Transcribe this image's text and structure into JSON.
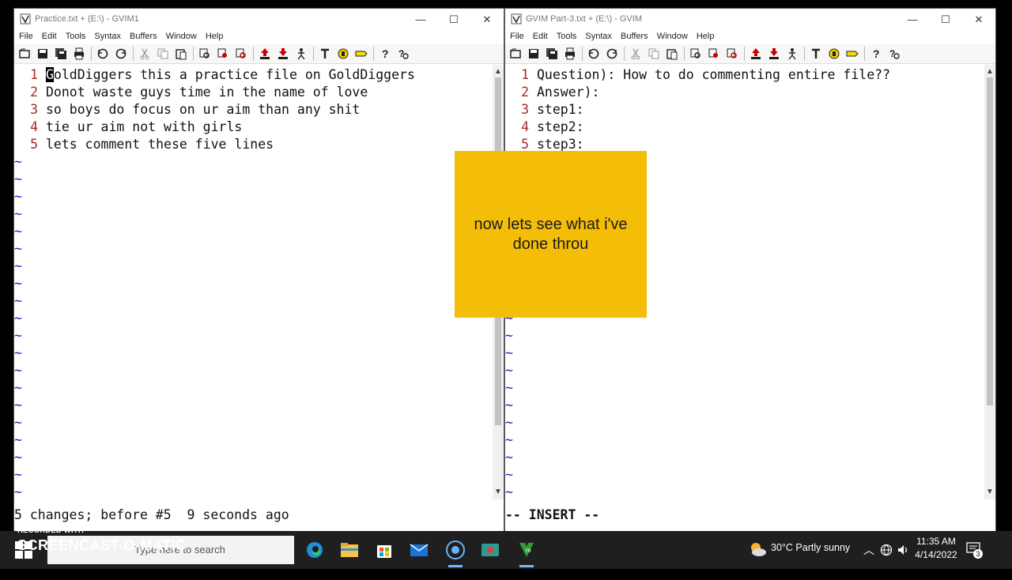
{
  "left_window": {
    "title": "Practice.txt + (E:\\) - GVIM1",
    "menu": [
      "File",
      "Edit",
      "Tools",
      "Syntax",
      "Buffers",
      "Window",
      "Help"
    ],
    "lines": [
      {
        "num": "1",
        "first": "G",
        "rest": "oldDiggers this a practice file on GoldDiggers"
      },
      {
        "num": "2",
        "text": "Donot waste guys time in the name of love"
      },
      {
        "num": "3",
        "text": "so boys do focus on ur aim than any shit"
      },
      {
        "num": "4",
        "text": "tie ur aim not with girls"
      },
      {
        "num": "5",
        "text": "lets comment these five lines"
      }
    ],
    "tilde": "~",
    "status": "5 changes; before #5  9 seconds ago"
  },
  "right_window": {
    "title": "GVIM Part-3.txt + (E:\\) - GVIM",
    "menu": [
      "File",
      "Edit",
      "Tools",
      "Syntax",
      "Buffers",
      "Window",
      "Help"
    ],
    "lines": [
      {
        "num": "1",
        "text": "Question): How to do commenting entire file??"
      },
      {
        "num": "2",
        "text": "Answer):"
      },
      {
        "num": "3",
        "text": "step1:"
      },
      {
        "num": "4",
        "text": "step2:"
      },
      {
        "num": "5",
        "text": "step3:"
      }
    ],
    "tilde": "~",
    "status": "-- INSERT --"
  },
  "overlay_note": "now lets see what i've done throu",
  "taskbar": {
    "search_placeholder": "Type here to search",
    "weather": "30°C  Partly sunny",
    "time": "11:35 AM",
    "date": "4/14/2022",
    "notification_count": "3"
  },
  "watermark": {
    "line1": "RECORDED WITH",
    "line2": "SCREENCAST-O-MATIC"
  },
  "colors": {
    "line_number": "#a52a2a",
    "tilde": "#1d1dcc",
    "note_background": "#f4bd08"
  }
}
